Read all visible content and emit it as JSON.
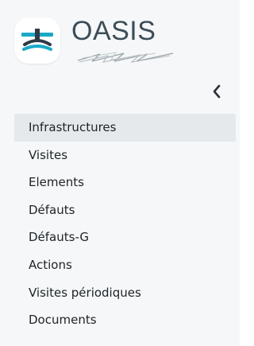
{
  "brand": {
    "name": "OASIS",
    "logo_icon": "bridge-logo-icon",
    "subtitle_icon": "redacted-scribble"
  },
  "collapse_icon": "chevron-left-icon",
  "menu": {
    "active_index": 0,
    "items": [
      {
        "label": "Infrastructures"
      },
      {
        "label": "Visites"
      },
      {
        "label": "Elements"
      },
      {
        "label": "Défauts"
      },
      {
        "label": "Défauts-G"
      },
      {
        "label": "Actions"
      },
      {
        "label": "Visites périodiques"
      },
      {
        "label": "Documents"
      }
    ]
  },
  "colors": {
    "sidebar_bg": "#f5f7f8",
    "active_bg": "#e6e9ec",
    "logo_teal": "#1aa9c7",
    "logo_dark": "#2f3a44"
  }
}
